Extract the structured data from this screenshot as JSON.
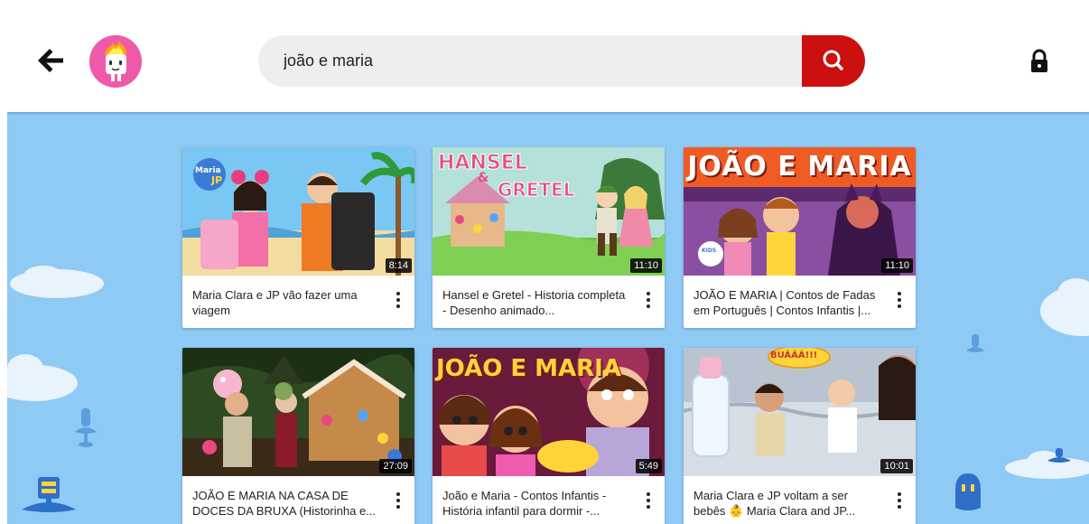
{
  "header": {
    "search": {
      "value": "joão e maria",
      "placeholder": ""
    },
    "icons": {
      "back": "arrow-left-icon",
      "avatar": "profile-avatar",
      "search": "search-icon",
      "lock": "lock-icon"
    }
  },
  "colors": {
    "background": "#8fcaf5",
    "search_button": "#cc0f0f",
    "avatar": "#ef5aa8"
  },
  "videos": [
    {
      "title": "Maria Clara e JP vão fazer uma viagem",
      "duration": "8:14",
      "thumb_text": ""
    },
    {
      "title": "Hansel e Gretel - Historia completa - Desenho animado...",
      "duration": "11:10",
      "thumb_text": "HANSEL & GRETEL"
    },
    {
      "title": "JOÃO E MARIA | Contos de Fadas em Português | Contos Infantis |...",
      "duration": "11:10",
      "thumb_text": "JOÃO E MARIA"
    },
    {
      "title": "JOÃO E MARIA NA CASA DE DOCES DA BRUXA (Historinha e...",
      "duration": "27:09",
      "thumb_text": ""
    },
    {
      "title": "João e Maria - Contos Infantis - História infantil para dormir -...",
      "duration": "5:49",
      "thumb_text": "JOÃO E MARIA"
    },
    {
      "title": "Maria Clara e JP voltam a ser bebês 👶 Maria Clara and JP...",
      "duration": "10:01",
      "thumb_text": "BUÁÁÁ!!!"
    }
  ]
}
